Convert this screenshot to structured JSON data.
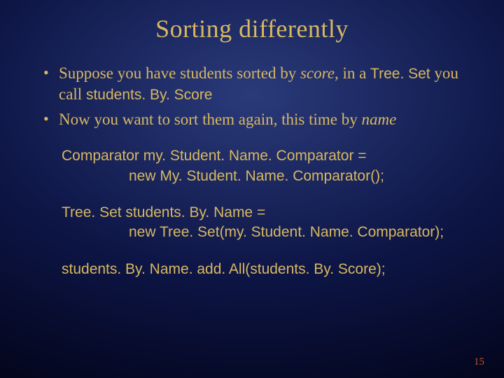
{
  "title": "Sorting differently",
  "bullets": [
    {
      "pre": "Suppose you have students sorted by ",
      "em": "score",
      "mid": ", in a ",
      "code1": "Tree. Set",
      "mid2": " you call ",
      "code2": "students. By. Score"
    },
    {
      "pre": "Now you want to sort them again, this time by ",
      "em": "name"
    }
  ],
  "code": {
    "b1l1": "Comparator my. Student. Name. Comparator =",
    "b1l2": "new My. Student. Name. Comparator();",
    "b2l1": "Tree. Set students. By. Name =",
    "b2l2": "new Tree. Set(my. Student. Name. Comparator);",
    "b3l1": "students. By. Name. add. All(students. By. Score);"
  },
  "page": "15"
}
